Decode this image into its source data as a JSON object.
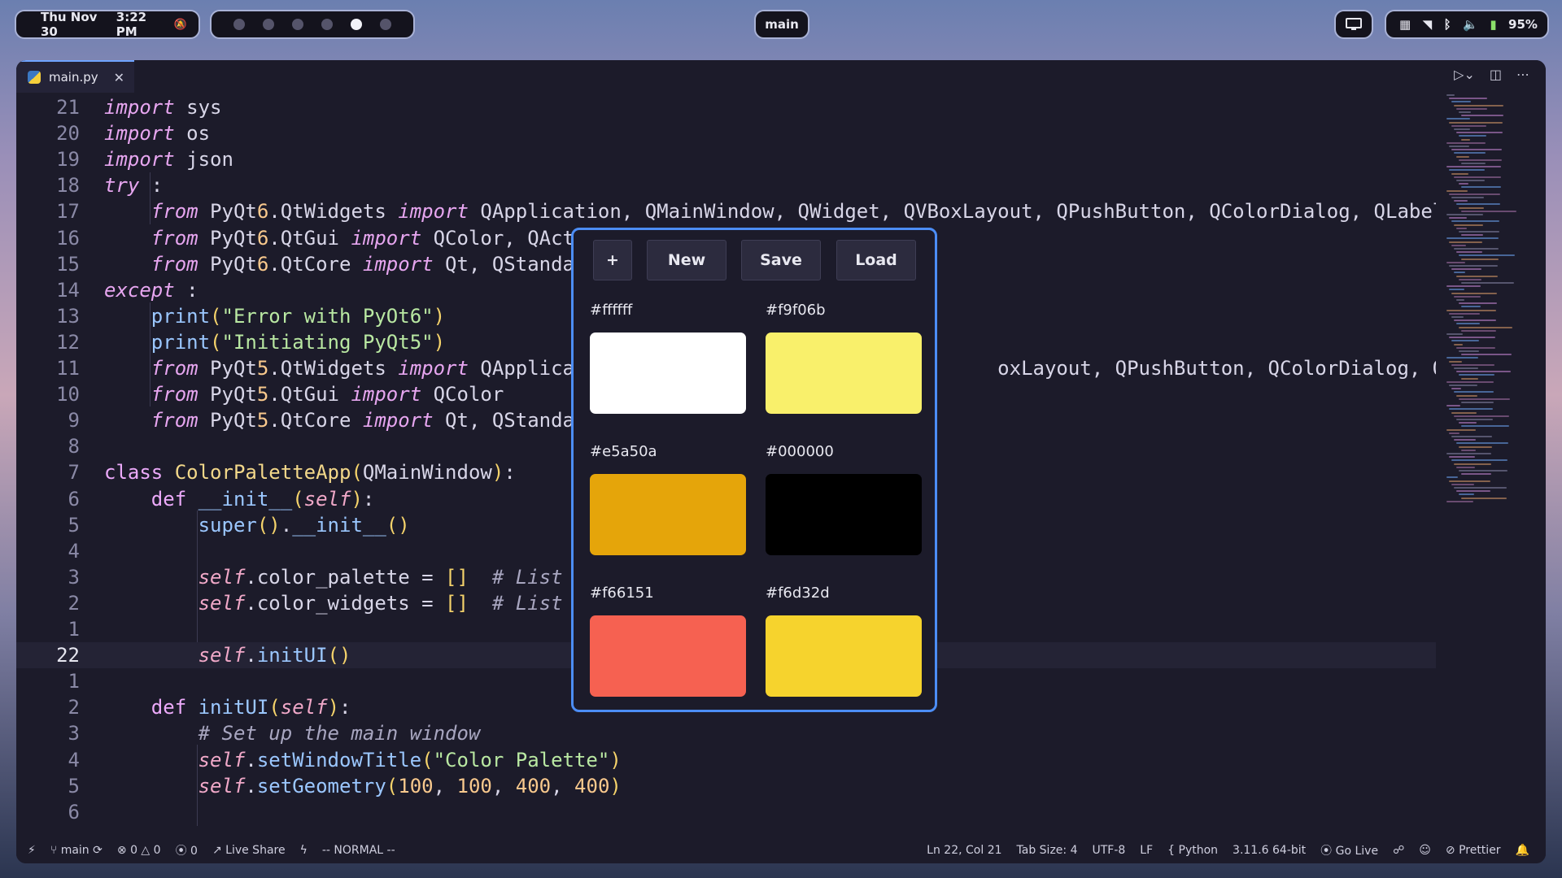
{
  "topbar": {
    "date": "Thu Nov 30",
    "time": "3:22 PM",
    "branch": "main",
    "battery": "95%",
    "icons": [
      "bell-off-icon",
      "display-icon",
      "grid-icon",
      "wifi-icon",
      "bluetooth-icon",
      "volume-icon",
      "battery-icon"
    ]
  },
  "tab": {
    "filename": "main.py"
  },
  "code_lines": [
    {
      "n": "21",
      "t": "import sys"
    },
    {
      "n": "20",
      "t": "import os"
    },
    {
      "n": "19",
      "t": "import json"
    },
    {
      "n": "18",
      "t": "try :"
    },
    {
      "n": "17",
      "t": "    from PyQt6.QtWidgets import QApplication, QMainWindow, QWidget, QVBoxLayout, QPushButton, QColorDialog, QLabel"
    },
    {
      "n": "16",
      "t": "    from PyQt6.QtGui import QColor, QAct"
    },
    {
      "n": "15",
      "t": "    from PyQt6.QtCore import Qt, QStanda"
    },
    {
      "n": "14",
      "t": "except :"
    },
    {
      "n": "13",
      "t": "    print(\"Error with PyOt6\")"
    },
    {
      "n": "12",
      "t": "    print(\"Initiating PyQt5\")"
    },
    {
      "n": "11",
      "t": "    from PyQt5.QtWidgets import QApplica                                    oxLayout, QPushButton, QColorDialog, QLabel"
    },
    {
      "n": "10",
      "t": "    from PyQt5.QtGui import QColor"
    },
    {
      "n": "9",
      "t": "    from PyQt5.QtCore import Qt, QStanda"
    },
    {
      "n": "8",
      "t": ""
    },
    {
      "n": "7",
      "t": "class ColorPaletteApp(QMainWindow):"
    },
    {
      "n": "6",
      "t": "    def __init__(self):"
    },
    {
      "n": "5",
      "t": "        super().__init__()"
    },
    {
      "n": "4",
      "t": ""
    },
    {
      "n": "3",
      "t": "        self.color_palette = []  # List"
    },
    {
      "n": "2",
      "t": "        self.color_widgets = []  # List"
    },
    {
      "n": "1",
      "t": ""
    },
    {
      "n": "22",
      "t": "        self.initUI()"
    },
    {
      "n": "1",
      "t": ""
    },
    {
      "n": "2",
      "t": "    def initUI(self):"
    },
    {
      "n": "3",
      "t": "        # Set up the main window"
    },
    {
      "n": "4",
      "t": "        self.setWindowTitle(\"Color Palette\")"
    },
    {
      "n": "5",
      "t": "        self.setGeometry(100, 100, 400, 400)"
    },
    {
      "n": "6",
      "t": ""
    }
  ],
  "current_line_index": 21,
  "popup": {
    "buttons": {
      "add": "+",
      "new": "New",
      "save": "Save",
      "load": "Load"
    },
    "swatches": [
      {
        "label": "#ffffff",
        "color": "#ffffff"
      },
      {
        "label": "#f9f06b",
        "color": "#f9f06b"
      },
      {
        "label": "#e5a50a",
        "color": "#e5a50a"
      },
      {
        "label": "#000000",
        "color": "#000000"
      },
      {
        "label": "#f66151",
        "color": "#f66151"
      },
      {
        "label": "#f6d32d",
        "color": "#f6d32d"
      }
    ]
  },
  "status": {
    "branch": "main",
    "errors": "0",
    "warnings": "0",
    "ports": "0",
    "live_share": "Live Share",
    "mode": "-- NORMAL --",
    "position": "Ln 22, Col 21",
    "tab_size": "Tab Size: 4",
    "encoding": "UTF-8",
    "eol": "LF",
    "language": "Python",
    "interpreter": "3.11.6 64-bit",
    "go_live": "Go Live",
    "prettier": "Prettier"
  }
}
